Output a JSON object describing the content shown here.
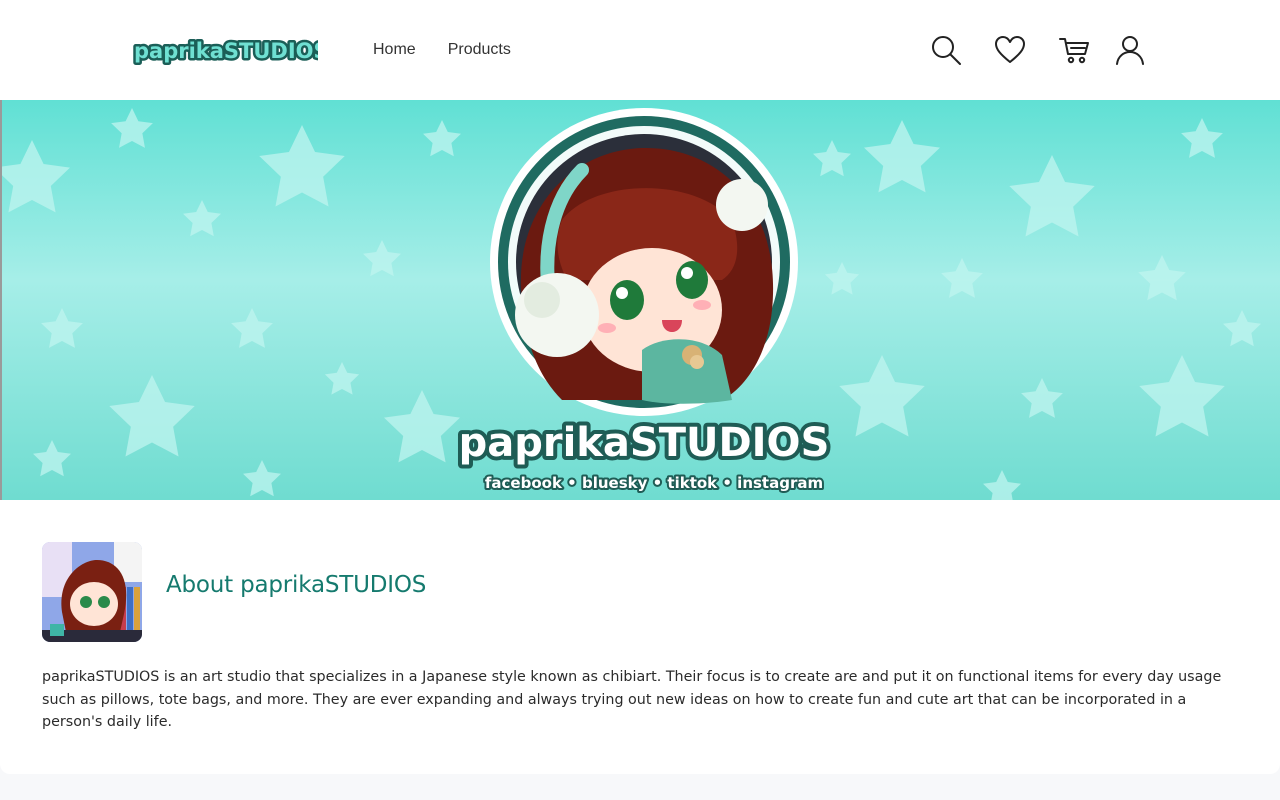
{
  "header": {
    "logo_text": "paprikaSTUDIOS",
    "nav": [
      {
        "label": "Home"
      },
      {
        "label": "Products"
      }
    ],
    "icons": [
      "search-icon",
      "heart-icon",
      "cart-icon",
      "user-icon"
    ]
  },
  "banner": {
    "brand_text": "paprikaSTUDIOS",
    "socials": "facebook • bluesky • tiktok • instagram"
  },
  "about": {
    "title": "About paprikaSTUDIOS",
    "description": "paprikaSTUDIOS is an art studio that specializes in a Japanese style known as chibiart. Their focus is to create are and put it on functional items for every day usage such as pillows, tote bags, and more. They are ever expanding and always trying out new ideas on how to create fun and cute art that can be incorporated in a person's daily life."
  },
  "colors": {
    "accent": "#157a6e",
    "banner_bg": "#6fe3d8",
    "page_bg": "#f7f8fa"
  }
}
